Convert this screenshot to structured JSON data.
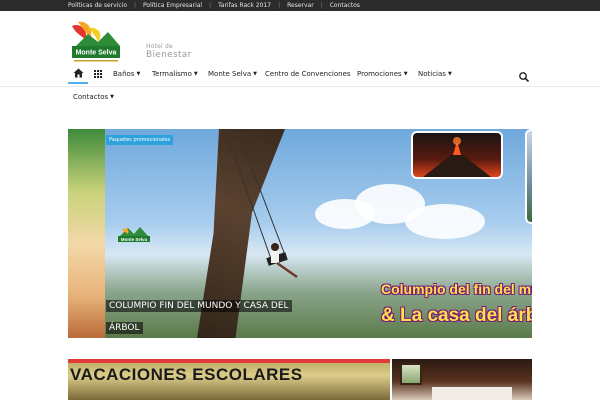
{
  "topbar": {
    "links": [
      "Políticas de servicio",
      "Política Empresarial",
      "Tarifas Rack 2017",
      "Reservar",
      "Contactos"
    ]
  },
  "brand": {
    "logo_text": "Monte Selva",
    "tagline_line1": "Hotel de",
    "tagline_line2": "Bienestar"
  },
  "nav": {
    "home_icon": "home-icon",
    "grid_icon": "grid-icon",
    "items": [
      "Baños",
      "Termalismo",
      "Monte Selva",
      "Centro de Convenciones",
      "Promociones",
      "Noticias"
    ],
    "has_dropdown": [
      true,
      true,
      true,
      false,
      true,
      true
    ],
    "second_row": "Contactos",
    "search_icon": "search-icon"
  },
  "hero": {
    "category_badge": "Paquetes promocionales",
    "caption": "COLUMPIO FIN DEL MUNDO Y CASA DEL ÁRBOL",
    "poster_line1": "Columpio del fin del mundo",
    "poster_line2": "& La casa del árb",
    "small_logo_text": "Monte Selva"
  },
  "tiles": {
    "tile1_title": "VACACIONES ESCOLARES"
  },
  "colors": {
    "accent": "#4db2ec",
    "badge": "#2ea2dc",
    "topbar_bg": "#2b2b2b"
  }
}
